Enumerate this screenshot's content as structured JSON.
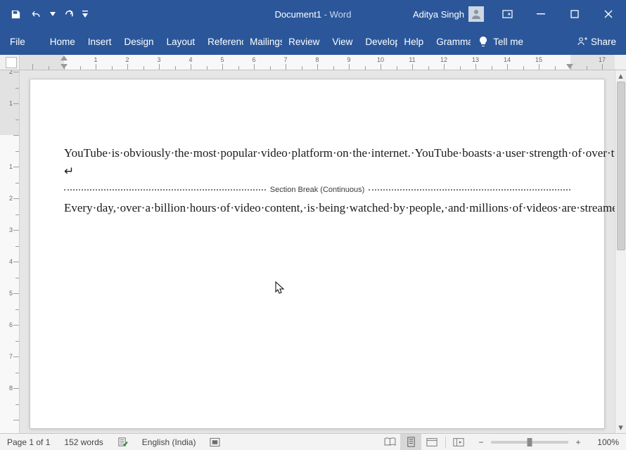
{
  "titlebar": {
    "doc_name": "Document1",
    "app_suffix": " - Word",
    "user_name": "Aditya Singh"
  },
  "ribbon": {
    "tabs": [
      "File",
      "Home",
      "Insert",
      "Design",
      "Layout",
      "References",
      "Mailings",
      "Review",
      "View",
      "Developer",
      "Help",
      "Grammarly"
    ],
    "tell_me": "Tell me",
    "share": "Share"
  },
  "document": {
    "para1": "YouTube·is·obviously·the·most·popular·video·platform·on·the·internet.·YouTube·boasts·a·user·strength·of·over·two·billion·monthly·users·which·clearly·proves·the·fact·that·YouTube·is·one·of·the·most·popular·video·platform.·From·educational·content·to·films,·videos·related·to·everything·can·be·found·on·YouTube.|↵",
    "section_break_label": "Section Break (Continuous)",
    "para2": "Every·day,·over·a·billion·hours·of·video·content,·is·being·watched·by·people,·and·millions·of·videos·are·streamed·on·YouTube.·Such·global·reach·of·YouTube·is·one·of·the·reasons·people·choose·YouTube·to·upload·their·videos.·Another·reason·is·that·YouTube·is·free·to·use.·All·you·need·is·a·Google·Account·to·create·a·new·YouTube·channel.·After·creating·a·channel,·you·can·easily·upload·your·videos·on·YouTube·which·will·be·available·to·the·public·online.·When·your·videos·reach·a·certain·level·of·audience·and·subscribers,·YouTube·ads·are·a·good·way·to·earn·money.¶"
  },
  "statusbar": {
    "page": "Page 1 of 1",
    "words": "152 words",
    "language": "English (India)",
    "zoom_pct": "100%"
  },
  "ruler": {
    "h_labels": [
      1,
      2,
      3,
      4,
      5,
      6,
      7,
      8,
      9,
      10,
      11,
      12,
      13,
      14,
      15,
      17
    ],
    "v_labels": [
      1,
      2,
      1,
      2,
      3,
      4,
      5,
      6,
      7,
      8
    ]
  }
}
